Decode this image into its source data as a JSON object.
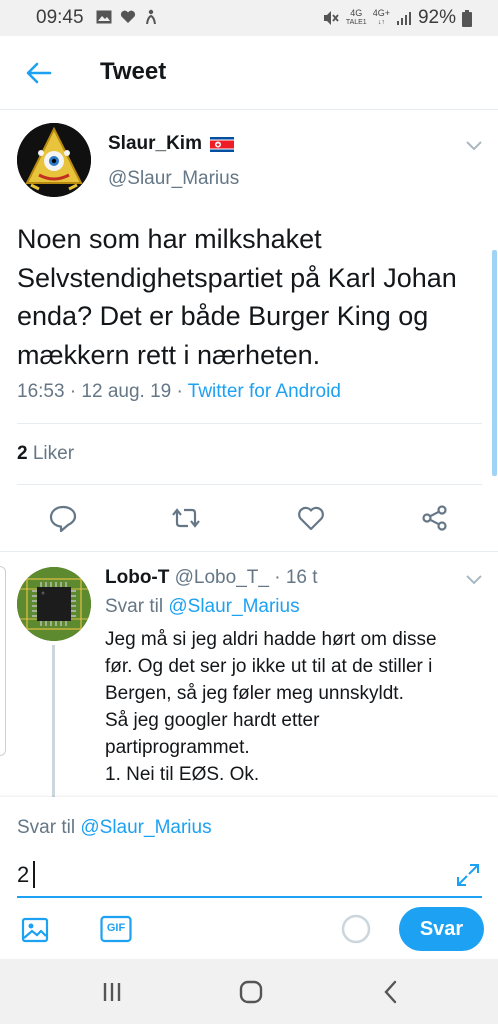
{
  "status_bar": {
    "time": "09:45",
    "left_icons": [
      "image-icon",
      "heart-icon",
      "accessibility-icon"
    ],
    "net_top": "4G",
    "net_sub": "TALE1",
    "net2_top": "4G+",
    "battery_pct": "92%"
  },
  "header": {
    "title": "Tweet"
  },
  "tweet": {
    "author_name": "Slaur_Kim",
    "author_handle": "@Slaur_Marius",
    "text": "Noen som har milkshaket Selvstendighetspartiet på Karl Johan enda? Det er både Burger King og mækkern rett i nærheten.",
    "time": "16:53 · 12 aug. 19 · ",
    "source": "Twitter for Android",
    "likes_count": "2",
    "likes_label": " Liker"
  },
  "reply": {
    "name": "Lobo-T",
    "handle_time": " @Lobo_T_ · 16 t",
    "reply_to_label": "Svar til ",
    "reply_to_mention": "@Slaur_Marius",
    "lines": [
      "Jeg må si jeg aldri hadde hørt om disse",
      "før.  Og det ser jo ikke ut til at de stiller i",
      "Bergen, så jeg føler meg unnskyldt.",
      "Så jeg googler hardt etter",
      "partiprogrammet.",
      "1. Nei til EØS.  Ok."
    ]
  },
  "composer": {
    "reply_to_label": "Svar til ",
    "reply_to_mention": "@Slaur_Marius",
    "input_value": "2",
    "gif_label": "GIF",
    "submit_label": "Svar"
  },
  "colors": {
    "accent": "#1da1f2",
    "muted": "#657786",
    "text": "#14171a"
  }
}
